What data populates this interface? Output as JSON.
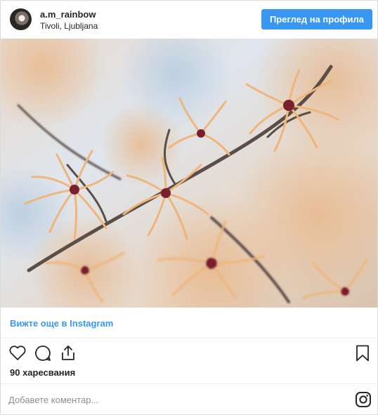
{
  "header": {
    "username": "a.m_rainbow",
    "location": "Tivoli, Ljubljana",
    "profile_button": "Преглед на профила"
  },
  "view_more": "Вижте още в Instagram",
  "likes": "90 харесвания",
  "comment": {
    "placeholder": "Добавете коментар..."
  },
  "icons": [
    "heart-icon",
    "comment-icon",
    "share-icon",
    "bookmark-icon",
    "instagram-icon"
  ],
  "colors": {
    "accent": "#3897f0",
    "text": "#262626",
    "muted": "#8e8e8e",
    "border": "#dbdbdb"
  }
}
